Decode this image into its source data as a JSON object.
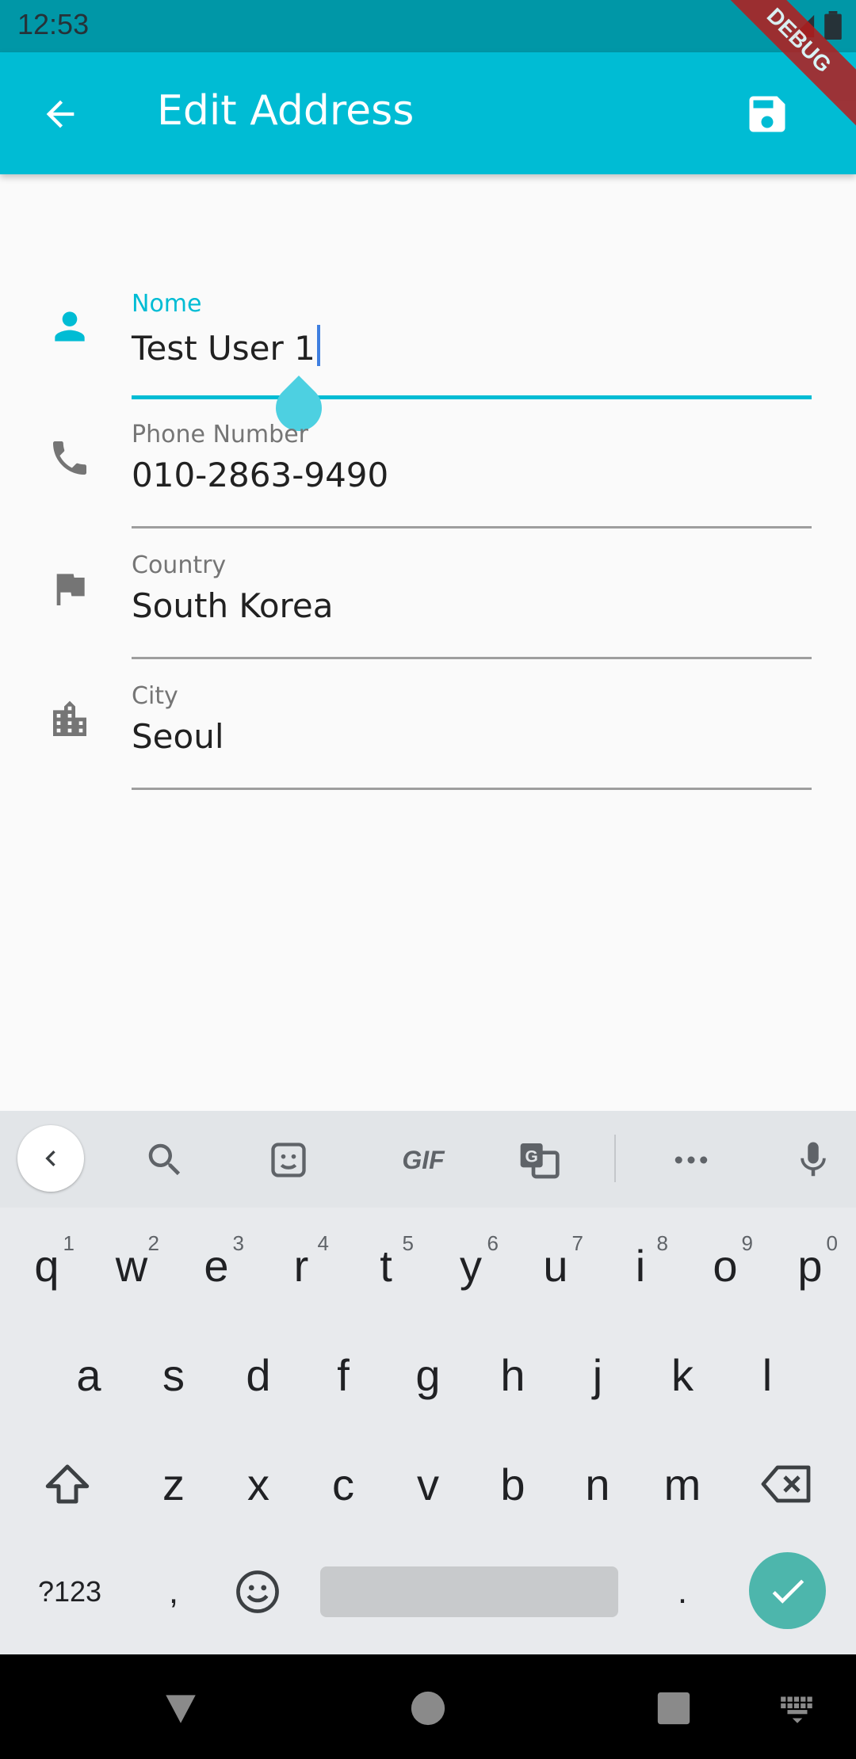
{
  "status_bar": {
    "time": "12:53"
  },
  "app_bar": {
    "title": "Edit Address",
    "debug_banner": "DEBUG"
  },
  "form": {
    "name": {
      "label": "Nome",
      "value": "Test User 1"
    },
    "phone": {
      "label": "Phone Number",
      "value": "010-2863-9490"
    },
    "country": {
      "label": "Country",
      "value": "South Korea"
    },
    "city": {
      "label": "City",
      "value": "Seoul"
    }
  },
  "colors": {
    "primary": "#00bcd4",
    "primary_dark": "#0097a7",
    "enter_key": "#4db6ac"
  },
  "keyboard": {
    "toolbar": {
      "gif": "GIF"
    },
    "row1": [
      {
        "k": "q",
        "h": "1"
      },
      {
        "k": "w",
        "h": "2"
      },
      {
        "k": "e",
        "h": "3"
      },
      {
        "k": "r",
        "h": "4"
      },
      {
        "k": "t",
        "h": "5"
      },
      {
        "k": "y",
        "h": "6"
      },
      {
        "k": "u",
        "h": "7"
      },
      {
        "k": "i",
        "h": "8"
      },
      {
        "k": "o",
        "h": "9"
      },
      {
        "k": "p",
        "h": "0"
      }
    ],
    "row2": [
      "a",
      "s",
      "d",
      "f",
      "g",
      "h",
      "j",
      "k",
      "l"
    ],
    "row3": [
      "z",
      "x",
      "c",
      "v",
      "b",
      "n",
      "m"
    ],
    "row4": {
      "symbols": "?123",
      "comma": ",",
      "period": "."
    }
  }
}
